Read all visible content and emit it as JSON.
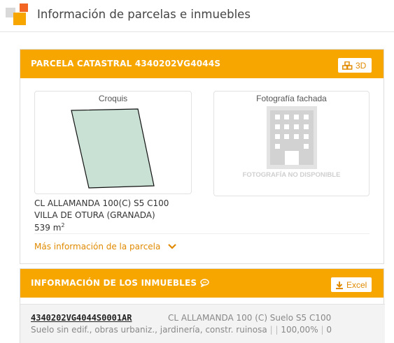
{
  "header": {
    "title": "Información de parcelas e inmuebles"
  },
  "parcela": {
    "title": "PARCELA CATASTRAL 4340202VG4044S",
    "btn_3d": "3D",
    "croquis_label": "Croquis",
    "fachada_label": "Fotografía fachada",
    "photo_unavailable": "FOTOGRAFÍA NO DISPONIBLE",
    "address_line1": "CL ALLAMANDA 100(C) S5 C100",
    "address_line2": "VILLA DE OTURA (GRANADA)",
    "area_value": "539 m",
    "area_unit_sup": "2",
    "more_info_link": "Más información de la parcela"
  },
  "inmuebles": {
    "title": "INFORMACIÓN DE LOS INMUEBLES",
    "excel_label": "Excel",
    "rows": [
      {
        "ref": "4340202VG4044S0001AR",
        "address": "CL ALLAMANDA 100 (C) Suelo S5 C100",
        "use": "Suelo sin edif., obras urbaniz., jardinería, constr. ruinosa",
        "sep": "|",
        "empty": "",
        "percent": "100,00%",
        "count": "0"
      }
    ]
  },
  "colors": {
    "accent": "#f7a600",
    "accent_text": "#e08a00",
    "parcel_fill": "#c9e0d4",
    "logo_orange": "#f26522"
  }
}
